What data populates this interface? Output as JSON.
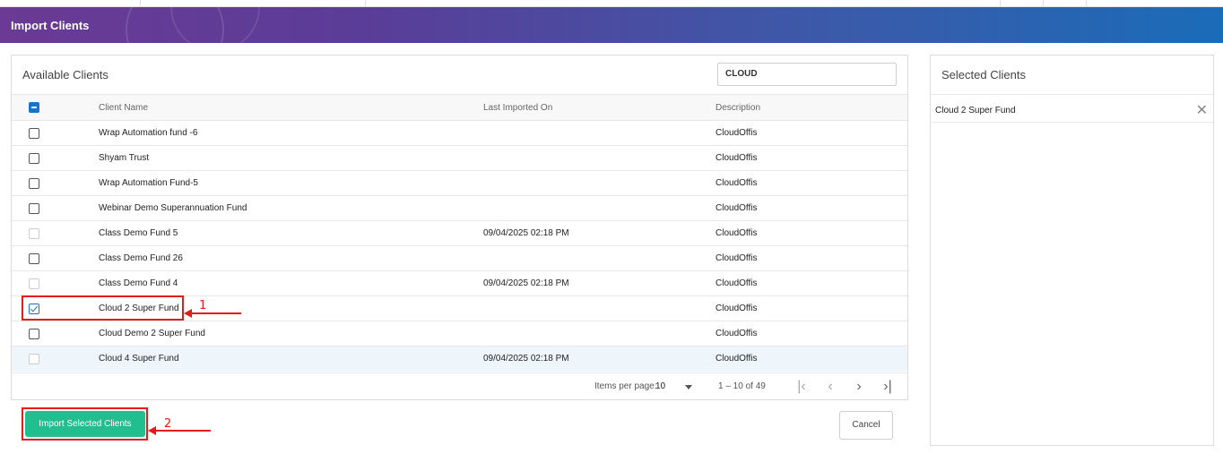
{
  "header": {
    "title": "Import Clients"
  },
  "available": {
    "title": "Available Clients",
    "search_value": "CLOUD",
    "columns": {
      "name": "Client Name",
      "imported": "Last Imported On",
      "description": "Description"
    },
    "rows": [
      {
        "name": "Wrap Automation fund -6",
        "imported": "",
        "description": "CloudOffis"
      },
      {
        "name": "Shyam Trust",
        "imported": "",
        "description": "CloudOffis"
      },
      {
        "name": "Wrap Automation Fund-5",
        "imported": "",
        "description": "CloudOffis"
      },
      {
        "name": "Webinar Demo Superannuation Fund",
        "imported": "",
        "description": "CloudOffis"
      },
      {
        "name": "Class Demo Fund 5",
        "imported": "09/04/2025 02:18 PM",
        "description": "CloudOffis"
      },
      {
        "name": "Class Demo Fund 26",
        "imported": "",
        "description": "CloudOffis"
      },
      {
        "name": "Class Demo Fund 4",
        "imported": "09/04/2025 02:18 PM",
        "description": "CloudOffis"
      },
      {
        "name": "Cloud 2 Super Fund",
        "imported": "",
        "description": "CloudOffis"
      },
      {
        "name": "Cloud Demo 2 Super Fund",
        "imported": "",
        "description": "CloudOffis"
      },
      {
        "name": "Cloud 4 Super Fund",
        "imported": "09/04/2025 02:18 PM",
        "description": "CloudOffis"
      }
    ]
  },
  "paginator": {
    "items_label": "Items per page:",
    "items_value": "10",
    "range": "1 – 10 of 49"
  },
  "actions": {
    "import_label": "Import Selected Clients",
    "cancel_label": "Cancel"
  },
  "selected": {
    "title": "Selected Clients",
    "items": [
      {
        "name": "Cloud 2 Super Fund"
      }
    ]
  },
  "annotations": {
    "step1": "1",
    "step2": "2"
  },
  "colors": {
    "accent": "#1a73c9",
    "import_button": "#21bf8f",
    "annotation": "#e31b1b"
  }
}
